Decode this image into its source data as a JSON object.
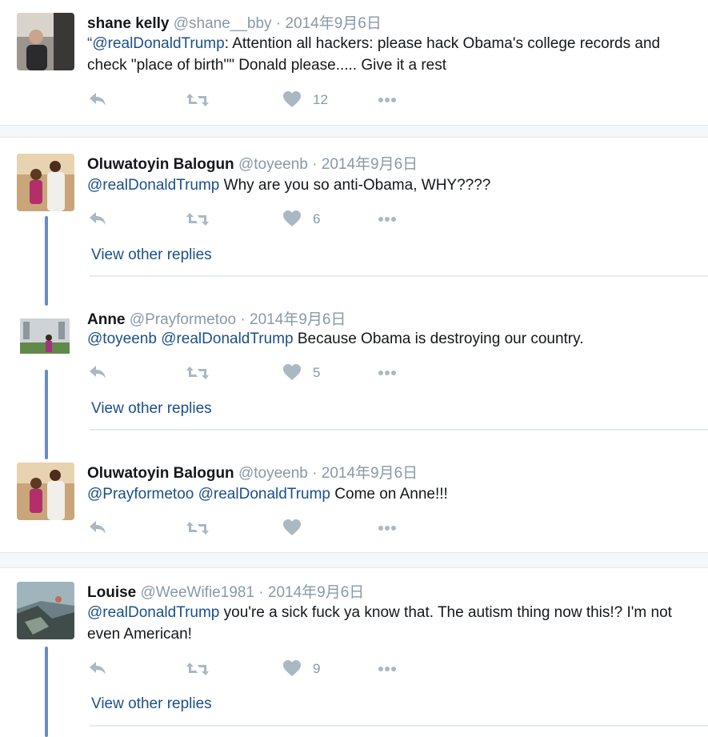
{
  "tweets": [
    {
      "name": "shane kelly",
      "handle": "@shane__bby",
      "separator": "·",
      "time": "2014年9月6日",
      "mention1": "“@realDonaldTrump",
      "text": ": Attention all hackers:  please hack Obama's college records and check \"place of birth\"\" Donald please..... Give it a rest",
      "likes": "12"
    },
    {
      "name": "Oluwatoyin Balogun",
      "handle": "@toyeenb",
      "separator": "·",
      "time": "2014年9月6日",
      "mention1": "@realDonaldTrump",
      "text": " Why are you so anti-Obama, WHY????",
      "likes": "6",
      "view_other_replies": "View other replies"
    },
    {
      "name": "Anne",
      "handle": "@Prayformetoo",
      "separator": "·",
      "time": "2014年9月6日",
      "mention1": "@toyeenb",
      "mention2": "@realDonaldTrump",
      "text": " Because Obama is destroying our country.",
      "likes": "5",
      "view_other_replies": "View other replies"
    },
    {
      "name": "Oluwatoyin Balogun",
      "handle": "@toyeenb",
      "separator": "·",
      "time": "2014年9月6日",
      "mention1": "@Prayformetoo",
      "mention2": "@realDonaldTrump",
      "text": " Come on Anne!!!",
      "likes": ""
    },
    {
      "name": "Louise",
      "handle": "@WeeWifie1981",
      "separator": "·",
      "time": "2014年9月6日",
      "mention1": "@realDonaldTrump",
      "text": " you're a sick fuck ya know that. The autism thing now this!? I'm not even American!",
      "likes": "9",
      "view_other_replies": "View other replies"
    }
  ],
  "icons": {
    "reply": "reply-icon",
    "retweet": "retweet-icon",
    "like": "heart-icon",
    "more": "more-icon"
  },
  "colors": {
    "icon": "#aab8c2",
    "mention": "#1b4f8a",
    "muted": "#8899a6",
    "thread_line": "#6b8bc0"
  }
}
